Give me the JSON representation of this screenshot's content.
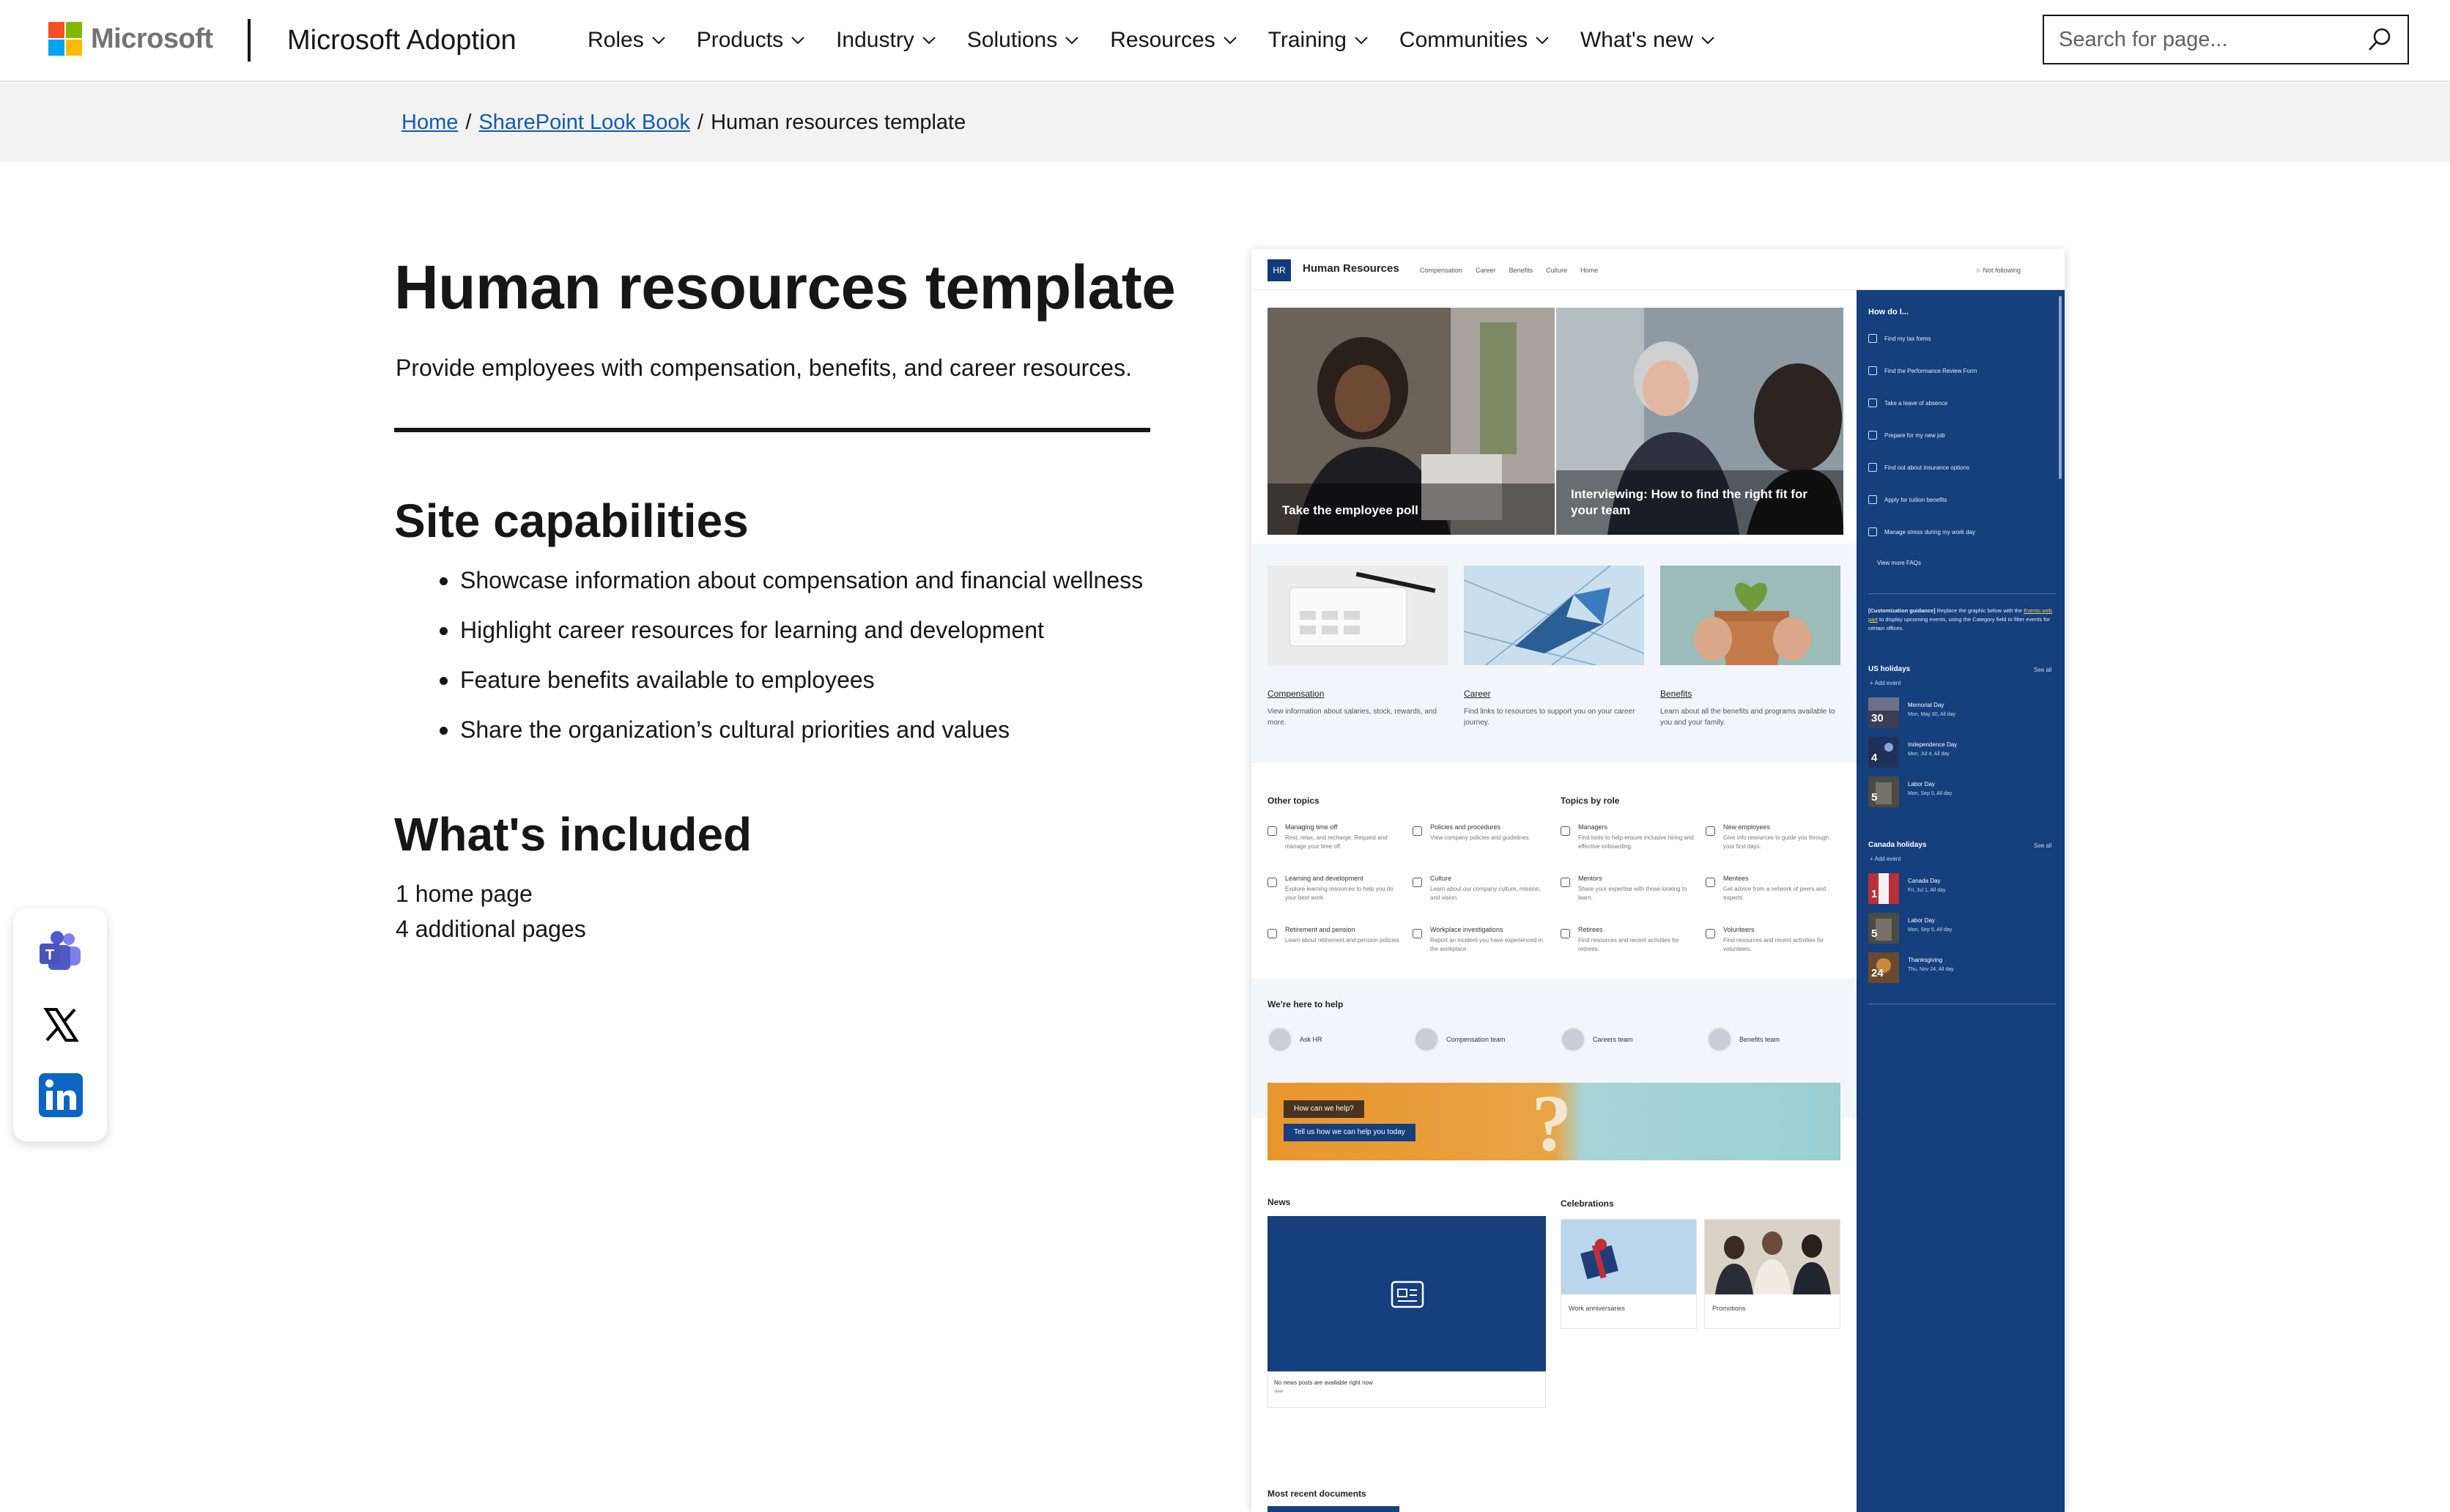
{
  "header": {
    "company": "Microsoft",
    "site_name": "Microsoft Adoption",
    "nav": [
      "Roles",
      "Products",
      "Industry",
      "Solutions",
      "Resources",
      "Training",
      "Communities",
      "What's new"
    ],
    "search_placeholder": "Search for page...",
    "logo_colors": [
      "#f25022",
      "#7fba00",
      "#00a4ef",
      "#ffb900"
    ]
  },
  "breadcrumb": {
    "home": "Home",
    "parent": "SharePoint Look Book",
    "sep": "/",
    "current": "Human resources template"
  },
  "main": {
    "title": "Human resources template",
    "description": "Provide employees with compensation, benefits, and career resources.",
    "capabilities_heading": "Site capabilities",
    "capabilities": [
      "Showcase information about compensation and financial wellness",
      "Highlight career resources for learning and development",
      "Feature benefits available to employees",
      "Share the organization’s cultural priorities and values"
    ],
    "included_heading": "What's included",
    "included": [
      "1 home page",
      "4 additional pages"
    ]
  },
  "share": [
    "teams-icon",
    "x-icon",
    "linkedin-icon"
  ],
  "preview": {
    "badge": "HR",
    "site": "Human Resources",
    "nav": [
      "Compensation",
      "Career",
      "Benefits",
      "Culture",
      "Home"
    ],
    "follow": "☆ Not following",
    "hero": [
      "Take the employee poll",
      "Interviewing: How to find the right fit for your team"
    ],
    "cards": [
      {
        "title": "Compensation",
        "desc": "View information about salaries, stock, rewards, and more."
      },
      {
        "title": "Career",
        "desc": "Find links to resources to support you on your career journey."
      },
      {
        "title": "Benefits",
        "desc": "Learn about all the benefits and programs available to you and your family."
      }
    ],
    "other_topics": "Other topics",
    "topics_by_role": "Topics by role",
    "topics": [
      {
        "name": "Managing time off",
        "desc": "Rest, relax, and recharge. Request and manage your time off."
      },
      {
        "name": "Policies and procedures",
        "desc": "View company policies and guidelines."
      },
      {
        "name": "Managers",
        "desc": "Find tools to help ensure inclusive hiring and effective onboarding."
      },
      {
        "name": "New employees",
        "desc": "Give info resources to guide you through your first days."
      },
      {
        "name": "Learning and development",
        "desc": "Explore learning resources to help you do your best work."
      },
      {
        "name": "Culture",
        "desc": "Learn about our company culture, mission, and vision."
      },
      {
        "name": "Mentors",
        "desc": "Share your expertise with those looking to learn."
      },
      {
        "name": "Mentees",
        "desc": "Get advice from a network of peers and experts."
      },
      {
        "name": "Retirement and pension",
        "desc": "Learn about retirement and pension policies."
      },
      {
        "name": "Workplace investigations",
        "desc": "Report an incident you have experienced in the workplace."
      },
      {
        "name": "Retirees",
        "desc": "Find resources and recent activities for retirees."
      },
      {
        "name": "Volunteers",
        "desc": "Find resources and recent activities for volunteers."
      }
    ],
    "help_heading": "We're here to help",
    "people": [
      "Ask HR",
      "Compensation team",
      "Careers team",
      "Benefits team"
    ],
    "banner_q": "How can we help?",
    "banner_btn": "Tell us how we can help you today",
    "news_heading": "News",
    "news_empty": "No news posts are available right now",
    "news_more": "view",
    "celebrations_heading": "Celebrations",
    "celebrations": [
      "Work anniversaries",
      "Promotions"
    ],
    "docs_heading": "Most recent documents",
    "sidebar": {
      "heading": "How do I...",
      "links": [
        "Find my tax forms",
        "Find the Performance Review Form",
        "Take a leave of absence",
        "Prepare for my new job",
        "Find out about insurance options",
        "Apply for tuition benefits",
        "Manage stress during my work day",
        "View more FAQs"
      ],
      "guidance_bold": "[Customization guidance]",
      "guidance_pre": " Replace the graphic below with the ",
      "guidance_link": "Events web part",
      "guidance_post": " to display upcoming events, using the Category field to filter events for certain offices.",
      "us_heading": "US holidays",
      "canada_heading": "Canada holidays",
      "see_all": "See all",
      "add_event": "+ Add event",
      "us_events": [
        {
          "num": "30",
          "name": "Memorial Day",
          "date": "Mon, May 30, All day"
        },
        {
          "num": "4",
          "name": "Independence Day",
          "date": "Mon, Jul 4, All day"
        },
        {
          "num": "5",
          "name": "Labor Day",
          "date": "Mon, Sep 5, All day"
        }
      ],
      "canada_events": [
        {
          "num": "1",
          "name": "Canada Day",
          "date": "Fri, Jul 1, All day"
        },
        {
          "num": "5",
          "name": "Labor Day",
          "date": "Mon, Sep 5, All day"
        },
        {
          "num": "24",
          "name": "Thanksgiving",
          "date": "Thu, Nov 24, All day"
        }
      ]
    }
  }
}
